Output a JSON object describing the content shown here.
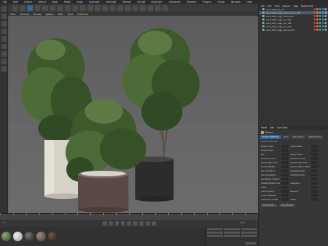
{
  "app": {
    "menu": [
      "File",
      "Edit",
      "Create",
      "Select",
      "Tools",
      "Mesh",
      "Snap",
      "Animate",
      "Simulate",
      "Render",
      "Sculpt",
      "MoGraph",
      "Character",
      "Pipeline",
      "Plugins",
      "Script",
      "Window",
      "Help"
    ]
  },
  "viewport": {
    "menu": [
      "View",
      "Cameras",
      "Display",
      "Options",
      "Filter",
      "Panel",
      "ProRender"
    ],
    "active_menu_index": 6
  },
  "object_manager": {
    "menu": [
      "File",
      "Edit",
      "View",
      "Objects",
      "Tags",
      "Bookmarks"
    ],
    "items": [
      {
        "name": "plant_064_big_set",
        "selected": false
      },
      {
        "name": "plant_064_Cage_small_fence_001",
        "selected": true
      },
      {
        "name": "plant_064_Cage_small_003",
        "selected": false
      },
      {
        "name": "plant_064_Cage_pot_001",
        "selected": false
      },
      {
        "name": "plant_064_Cage_pot_002",
        "selected": false
      },
      {
        "name": "plant_064_Cage_pot_003",
        "selected": false
      },
      {
        "name": "plant_064_Cage_leaves_001",
        "selected": false
      }
    ]
  },
  "attributes": {
    "menu": [
      "Mode",
      "Edit",
      "User Data"
    ],
    "title": "Project",
    "tabs": [
      "Project Settings",
      "Info",
      "Dynamics",
      "Referencing"
    ],
    "active_tab": 0,
    "section": "Project Settings",
    "rows": [
      {
        "left": "Project Scale",
        "right": "Centimeters"
      },
      {
        "left": "Scale Project...",
        "right": ""
      },
      {
        "left": "FPS",
        "right": "Project Time"
      },
      {
        "left": "Minimum Time",
        "right": "Maximum Time"
      },
      {
        "left": "Preview Min Time",
        "right": "Preview Max Time"
      },
      {
        "left": "Level of Detail",
        "right": "Render LOD in Editor"
      },
      {
        "left": "Use Animation",
        "right": "Use Expression"
      },
      {
        "left": "Use Generators",
        "right": "Use Deformers"
      },
      {
        "left": "Use Motion System",
        "right": ""
      },
      {
        "left": "Default Object Color",
        "right": "Gray-Blue"
      },
      {
        "left": "Color",
        "right": ""
      },
      {
        "left": "View Clipping",
        "right": "Medium"
      },
      {
        "left": "Linear Workflow",
        "right": ""
      },
      {
        "left": "Input Color Profile",
        "right": "sRGB"
      }
    ],
    "buttons": [
      "Load Preset...",
      "Save Preset..."
    ]
  },
  "timeline": {
    "frame_left": "0 F",
    "frame_right": "90 F"
  },
  "colors": {
    "foliage_dark": "#2f4a25",
    "foliage_mid": "#4d6b37",
    "foliage_light": "#7a8f5a",
    "pot_white": "#d6d2c8",
    "pot_brown": "#5a4a45",
    "pot_black": "#2c2c2c"
  }
}
